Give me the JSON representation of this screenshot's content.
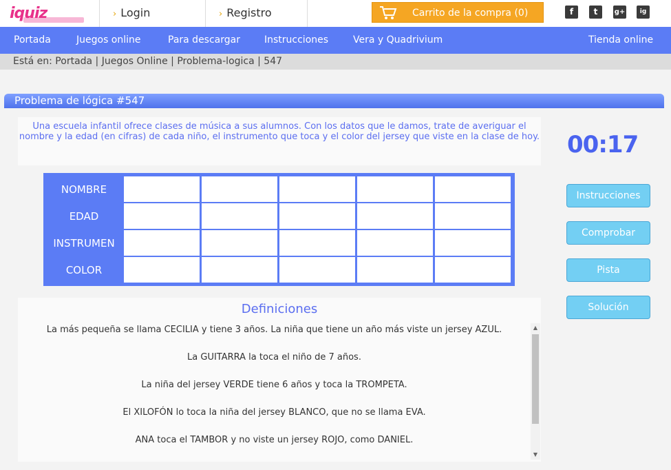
{
  "topbar": {
    "logo": "iquiz",
    "login": "Login",
    "register": "Registro",
    "cart": "Carrito de la compra (0)",
    "social": [
      "f",
      "t",
      "g+",
      "ig"
    ]
  },
  "nav": {
    "items": [
      "Portada",
      "Juegos online",
      "Para descargar",
      "Instrucciones",
      "Vera y Quadrivium"
    ],
    "shop": "Tienda online"
  },
  "breadcrumb": "Está en: Portada | Juegos Online | Problema-logica | 547",
  "puzzle": {
    "title": "Problema de lógica #547",
    "description": "Una escuela infantil ofrece clases de música a sus alumnos. Con los datos que le damos, trate de averiguar el nombre y la edad (en cifras) de cada niño, el instrumento que toca y el color del jersey que viste en la clase de hoy.",
    "timer": "00:17",
    "rows": [
      "NOMBRE",
      "EDAD",
      "INSTRUMEN",
      "COLOR"
    ]
  },
  "buttons": {
    "instructions": "Instrucciones",
    "check": "Comprobar",
    "hint": "Pista",
    "solution": "Solución"
  },
  "definitions": {
    "title": "Definiciones",
    "lines": [
      "La más pequeña se llama CECILIA y tiene 3 años. La niña que tiene un año más viste un jersey AZUL.",
      "La GUITARRA la toca el niño de 7 años.",
      "La niña del jersey VERDE tiene 6 años y toca la TROMPETA.",
      "El XILOFÓN lo toca la niña del jersey BLANCO, que no se llama EVA.",
      "ANA toca el TAMBOR y no viste un jersey ROJO, como DANIEL."
    ]
  },
  "colors": {
    "nav": "#5b7cf5",
    "accent_text": "#5b6ef0",
    "cart": "#f5a623",
    "buttons": "#73cff3"
  }
}
